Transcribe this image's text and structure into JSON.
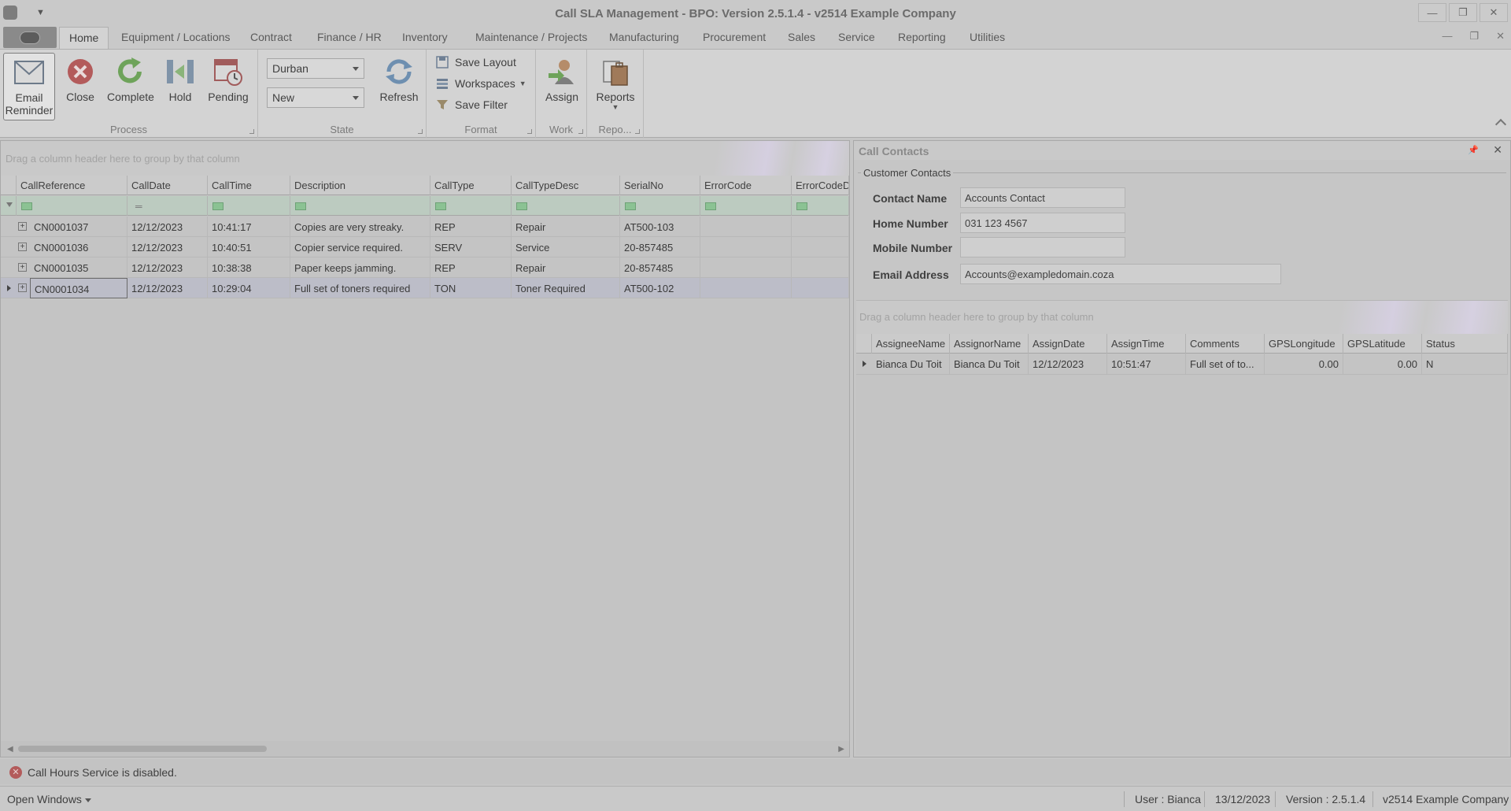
{
  "window": {
    "title": "Call SLA Management - BPO: Version 2.5.1.4 - v2514 Example Company",
    "minimize": "—",
    "restore": "❐",
    "close": "✕"
  },
  "tabs": [
    "Home",
    "Equipment / Locations",
    "Contract",
    "Finance / HR",
    "Inventory",
    "Maintenance / Projects",
    "Manufacturing",
    "Procurement",
    "Sales",
    "Service",
    "Reporting",
    "Utilities"
  ],
  "ribbon": {
    "process": {
      "label": "Process",
      "email_reminder": "Email Reminder",
      "close": "Close",
      "complete": "Complete",
      "hold": "Hold",
      "pending": "Pending"
    },
    "state": {
      "label": "State",
      "location": "Durban",
      "status": "New",
      "refresh": "Refresh"
    },
    "format": {
      "label": "Format",
      "save_layout": "Save Layout",
      "workspaces": "Workspaces",
      "save_filter": "Save Filter"
    },
    "work": {
      "label": "Work",
      "assign": "Assign"
    },
    "reports": {
      "label": "Repo...",
      "reports": "Reports"
    }
  },
  "calls_grid": {
    "group_hint": "Drag a column header here to group by that column",
    "columns": [
      "CallReference",
      "CallDate",
      "CallTime",
      "Description",
      "CallType",
      "CallTypeDesc",
      "SerialNo",
      "ErrorCode",
      "ErrorCodeD"
    ],
    "rows": [
      [
        "CN0001037",
        "12/12/2023",
        "10:41:17",
        "Copies are very streaky.",
        "REP",
        "Repair",
        "AT500-103",
        "",
        ""
      ],
      [
        "CN0001036",
        "12/12/2023",
        "10:40:51",
        "Copier service required.",
        "SERV",
        "Service",
        "20-857485",
        "",
        ""
      ],
      [
        "CN0001035",
        "12/12/2023",
        "10:38:38",
        "Paper keeps jamming.",
        "REP",
        "Repair",
        "20-857485",
        "",
        ""
      ],
      [
        "CN0001034",
        "12/12/2023",
        "10:29:04",
        "Full set of toners required",
        "TON",
        "Toner Required",
        "AT500-102",
        "",
        ""
      ]
    ]
  },
  "contacts": {
    "panel_title": "Call Contacts",
    "group_title": "Customer Contacts",
    "contact_name_label": "Contact Name",
    "contact_name": "Accounts Contact",
    "home_number_label": "Home Number",
    "home_number": "031 123 4567",
    "mobile_number_label": "Mobile Number",
    "mobile_number": "",
    "email_label": "Email Address",
    "email": "Accounts@exampledomain.coza"
  },
  "assign_grid": {
    "group_hint": "Drag a column header here to group by that column",
    "columns": [
      "AssigneeName",
      "AssignorName",
      "AssignDate",
      "AssignTime",
      "Comments",
      "GPSLongitude",
      "GPSLatitude",
      "Status"
    ],
    "rows": [
      [
        "Bianca Du Toit",
        "Bianca Du Toit",
        "12/12/2023",
        "10:51:47",
        "Full set of to...",
        "0.00",
        "0.00",
        "N"
      ]
    ]
  },
  "status": {
    "message": "Call Hours Service is disabled.",
    "open_windows": "Open Windows",
    "user": "User : Bianca",
    "date": "13/12/2023",
    "version": "Version : 2.5.1.4",
    "company": "v2514 Example Company"
  }
}
